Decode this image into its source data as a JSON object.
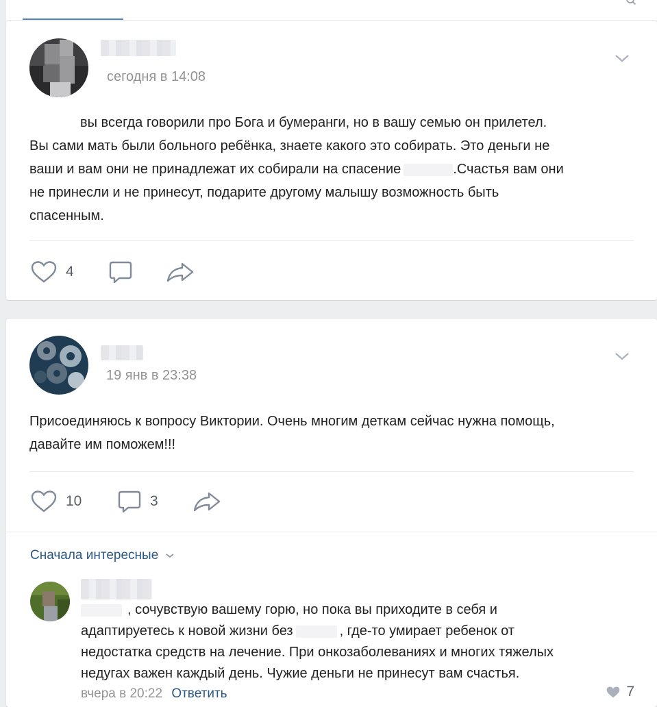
{
  "post1": {
    "date": "сегодня в 14:08",
    "text_line1": "вы всегда говорили про Бога и бумеранги, но в вашу семью он прилетел.",
    "text_line2": "Вы сами мать были больного ребёнка, знаете какого это собирать. Это деньги не",
    "text_line3a": "ваши и вам они не принадлежат их собирали на спасение",
    "text_line3b": ".Счастья вам они",
    "text_line4": "не принесли и не принесут, подарите другому малышу возможность быть",
    "text_line5": "спасенным.",
    "likes": "4"
  },
  "post2": {
    "date": "19 янв в 23:38",
    "text_line1": "Присоединяюсь к вопросу Виктории. Очень многим деткам сейчас нужна помощь,",
    "text_line2": "давайте им поможем!!!",
    "likes": "10",
    "comments": "3"
  },
  "comments": {
    "sort_label": "Сначала интересные",
    "items": [
      {
        "line1": ", сочувствую вашему горю, но пока вы приходите в себя и",
        "line2a": "адаптируетесь к новой жизни без",
        "line2b": ", где-то умирает ребенок от",
        "line3": "недостатка средств на лечение. При онкозаболеваниях и многих тяжелых",
        "line4": "недугах важен каждый день. Чужие деньги не принесут вам счастья.",
        "date": "вчера в 20:22",
        "reply_label": "Ответить",
        "likes": "7"
      }
    ]
  },
  "icons": {
    "like": "heart-icon",
    "comment": "comment-icon",
    "share": "share-icon",
    "menu": "chevron-down-icon",
    "search": "search-icon"
  },
  "colors": {
    "link": "#2a5885",
    "muted": "#939393",
    "icon": "#828a99",
    "background": "#edeef0"
  }
}
